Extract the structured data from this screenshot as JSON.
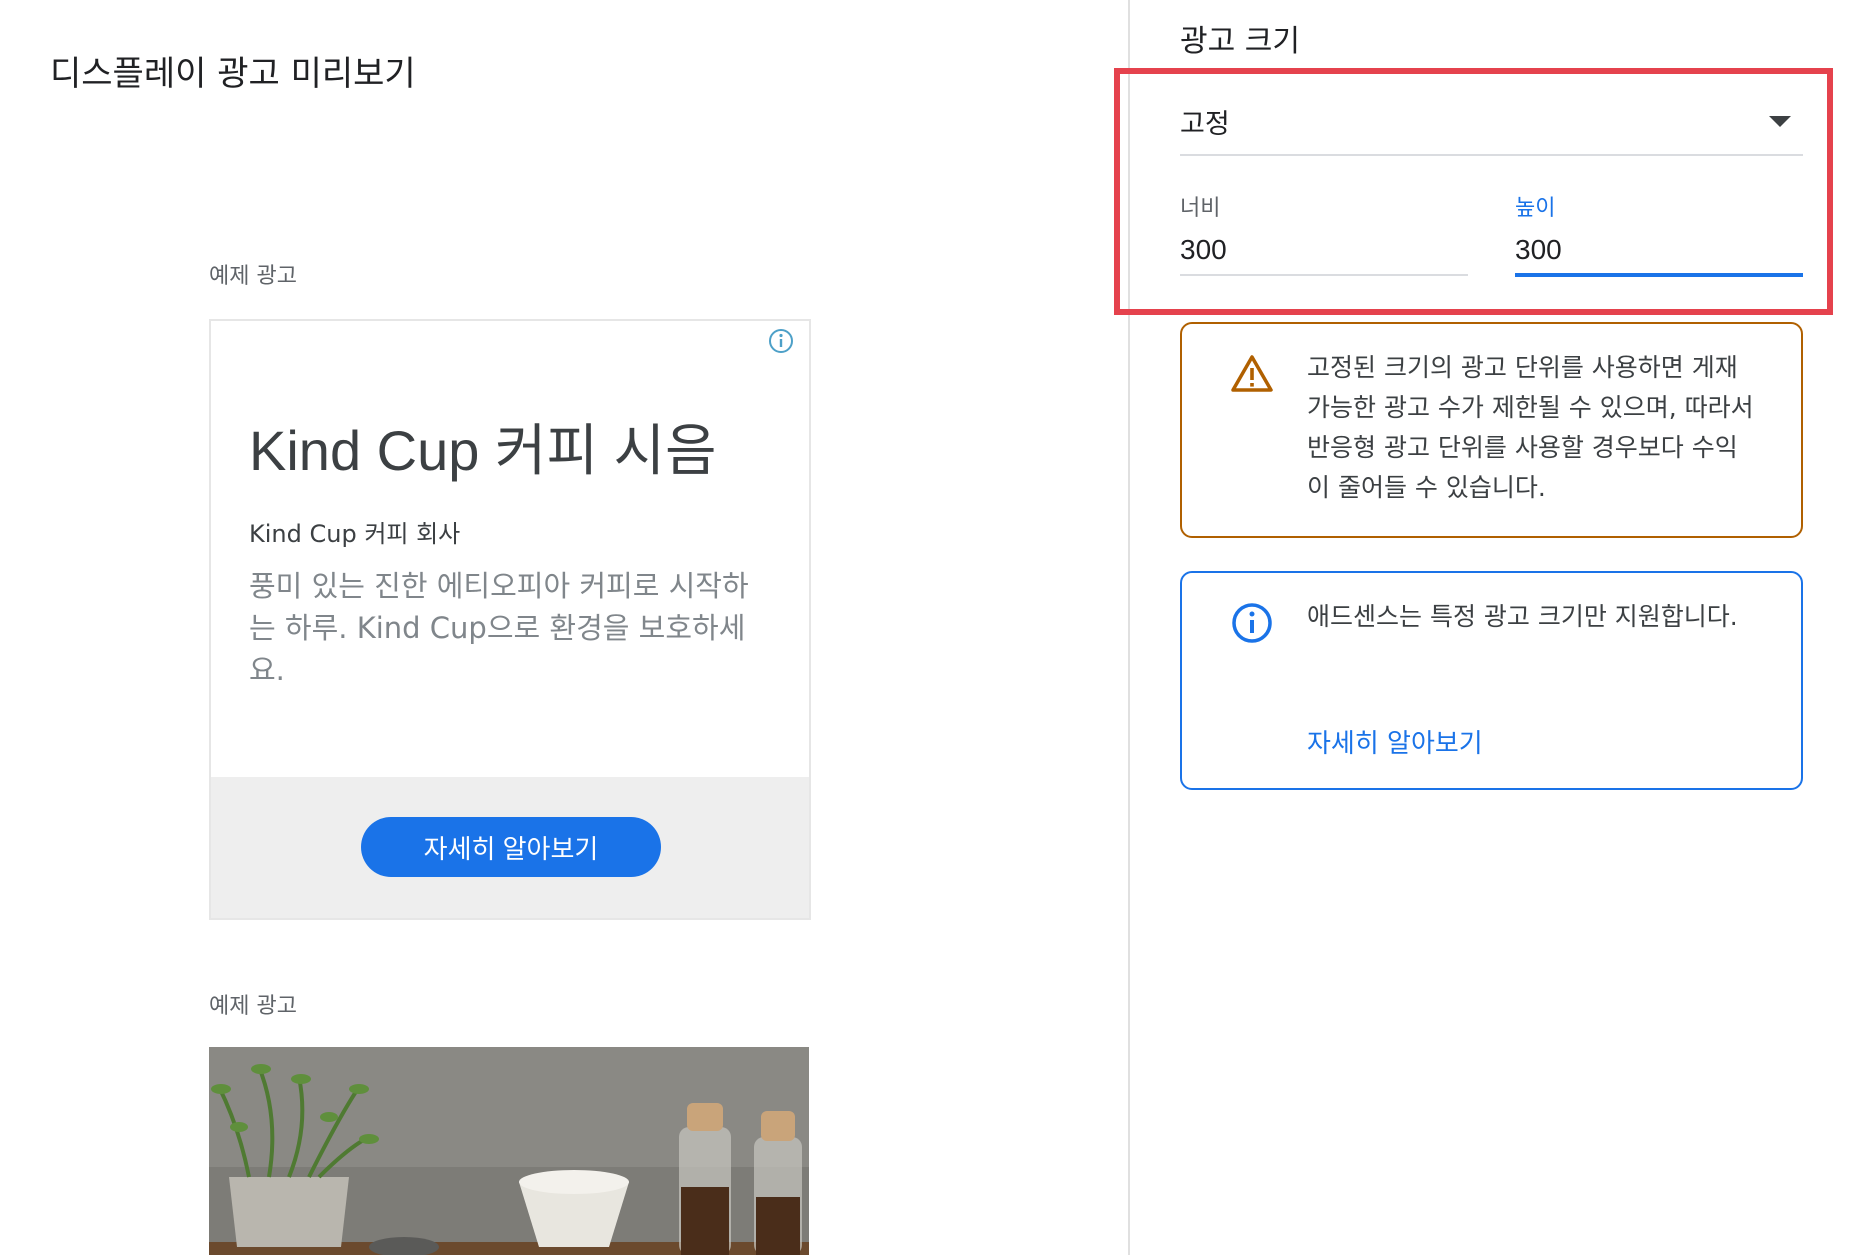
{
  "preview": {
    "title": "디스플레이 광고 미리보기",
    "sample_label_1": "예제 광고",
    "sample_label_2": "예제 광고",
    "ad": {
      "headline": "Kind Cup 커피 시음",
      "company": "Kind Cup 커피 회사",
      "description": "풍미 있는 진한 에티오피아 커피로 시작하는 하루. Kind Cup으로 환경을 보호하세요.",
      "cta": "자세히 알아보기"
    }
  },
  "settings": {
    "section_title": "광고 크기",
    "size_type": "고정",
    "width_label": "너비",
    "width_value": "300",
    "height_label": "높이",
    "height_value": "300"
  },
  "notices": {
    "warning_text": "고정된 크기의 광고 단위를 사용하면 게재 가능한 광고 수가 제한될 수 있으며, 따라서 반응형 광고 단위를 사용할 경우보다 수익이 줄어들 수 있습니다.",
    "info_text": "애드센스는 특정 광고 크기만 지원합니다.",
    "info_link": "자세히 알아보기"
  },
  "colors": {
    "accent": "#1a73e8",
    "warning": "#b06000",
    "highlight": "#e5424d"
  }
}
